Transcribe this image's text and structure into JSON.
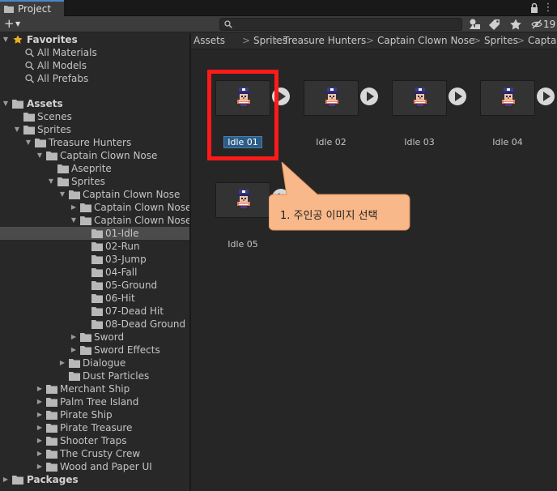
{
  "window": {
    "tab_title": "Project",
    "tab_icon": "folder-icon",
    "hidden_count": "19"
  },
  "toolbar": {
    "search_placeholder": "",
    "search_value": ""
  },
  "tree": {
    "favorites_label": "Favorites",
    "favorites": [
      "All Materials",
      "All Models",
      "All Prefabs"
    ],
    "assets_label": "Assets",
    "packages_label": "Packages",
    "items": [
      {
        "label": "Scenes"
      },
      {
        "label": "Sprites"
      },
      {
        "label": "Treasure Hunters"
      },
      {
        "label": "Captain Clown Nose"
      },
      {
        "label": "Aseprite"
      },
      {
        "label": "Sprites"
      },
      {
        "label": "Captain Clown Nose"
      },
      {
        "label": "Captain Clown Nose"
      },
      {
        "label": "Captain Clown Nose"
      },
      {
        "label": "01-Idle"
      },
      {
        "label": "02-Run"
      },
      {
        "label": "03-Jump"
      },
      {
        "label": "04-Fall"
      },
      {
        "label": "05-Ground"
      },
      {
        "label": "06-Hit"
      },
      {
        "label": "07-Dead Hit"
      },
      {
        "label": "08-Dead Ground"
      },
      {
        "label": "Sword"
      },
      {
        "label": "Sword Effects"
      },
      {
        "label": "Dialogue"
      },
      {
        "label": "Dust Particles"
      },
      {
        "label": "Merchant Ship"
      },
      {
        "label": "Palm Tree Island"
      },
      {
        "label": "Pirate Ship"
      },
      {
        "label": "Pirate Treasure"
      },
      {
        "label": "Shooter Traps"
      },
      {
        "label": "The Crusty Crew"
      },
      {
        "label": "Wood and Paper UI"
      }
    ]
  },
  "breadcrumb": [
    "Assets",
    "Sprites",
    "Treasure Hunters",
    "Captain Clown Nose",
    "Sprites",
    "Capta"
  ],
  "assets": [
    {
      "label": "Idle 01",
      "selected": true
    },
    {
      "label": "Idle 02"
    },
    {
      "label": "Idle 03"
    },
    {
      "label": "Idle 04"
    },
    {
      "label": "Idle 05"
    }
  ],
  "annotation": {
    "callout_text": "1. 주인공 이미지 선택",
    "highlight_color": "#ff1a1a",
    "callout_fill": "#f9b88a"
  },
  "colors": {
    "selection_blue": "#2c5d87",
    "tab_accent": "#4d86c8",
    "favorite_star": "#e8b21e"
  }
}
